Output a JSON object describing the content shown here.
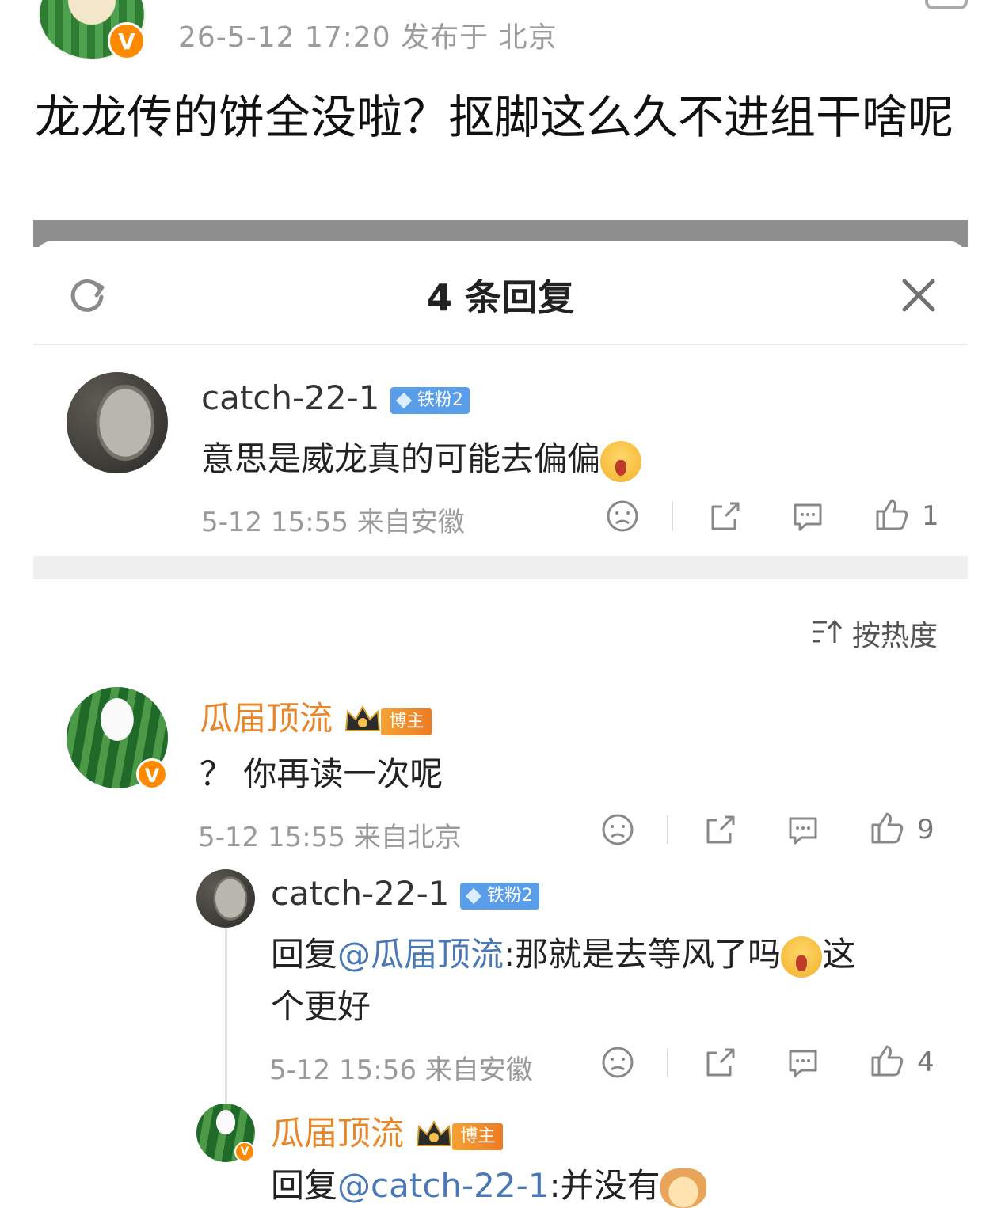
{
  "post": {
    "meta": "26-5-12 17:20   发布于 北京",
    "text": "龙龙传的饼全没啦？抠脚这么久不进组干啥呢"
  },
  "panel": {
    "title": "4 条回复"
  },
  "sort": {
    "label": "按热度"
  },
  "comments": [
    {
      "name": "catch-22-1",
      "badge": "铁粉2",
      "text": "意思是威龙真的可能去偏偏",
      "meta": "5-12 15:55  来自安徽",
      "likes": "1"
    },
    {
      "name": "瓜届顶流",
      "badge": "博主",
      "text": "？ 你再读一次呢",
      "meta": "5-12 15:55  来自北京",
      "likes": "9"
    },
    {
      "name": "catch-22-1",
      "badge": "铁粉2",
      "prefix": "回复",
      "mention": "@瓜届顶流",
      "text_line1": ":那就是去等风了吗",
      "text_line1_tail": "这",
      "text_line2": "个更好",
      "meta": "5-12 15:56  来自安徽",
      "likes": "4"
    },
    {
      "name": "瓜届顶流",
      "badge": "博主",
      "prefix": "回复",
      "mention": "@catch-22-1",
      "text": ":并没有"
    }
  ],
  "icons": {
    "refresh": "refresh-icon",
    "close": "close-icon",
    "dislike": "dislike-face-icon",
    "share": "share-icon",
    "reply": "reply-bubble-icon",
    "like": "thumbs-up-icon",
    "sort": "sort-icon"
  },
  "colors": {
    "mention": "#4a78b5",
    "blogger_name": "#e8862a",
    "fan_badge": "#5a9de8",
    "verified": "#ff8a00"
  }
}
